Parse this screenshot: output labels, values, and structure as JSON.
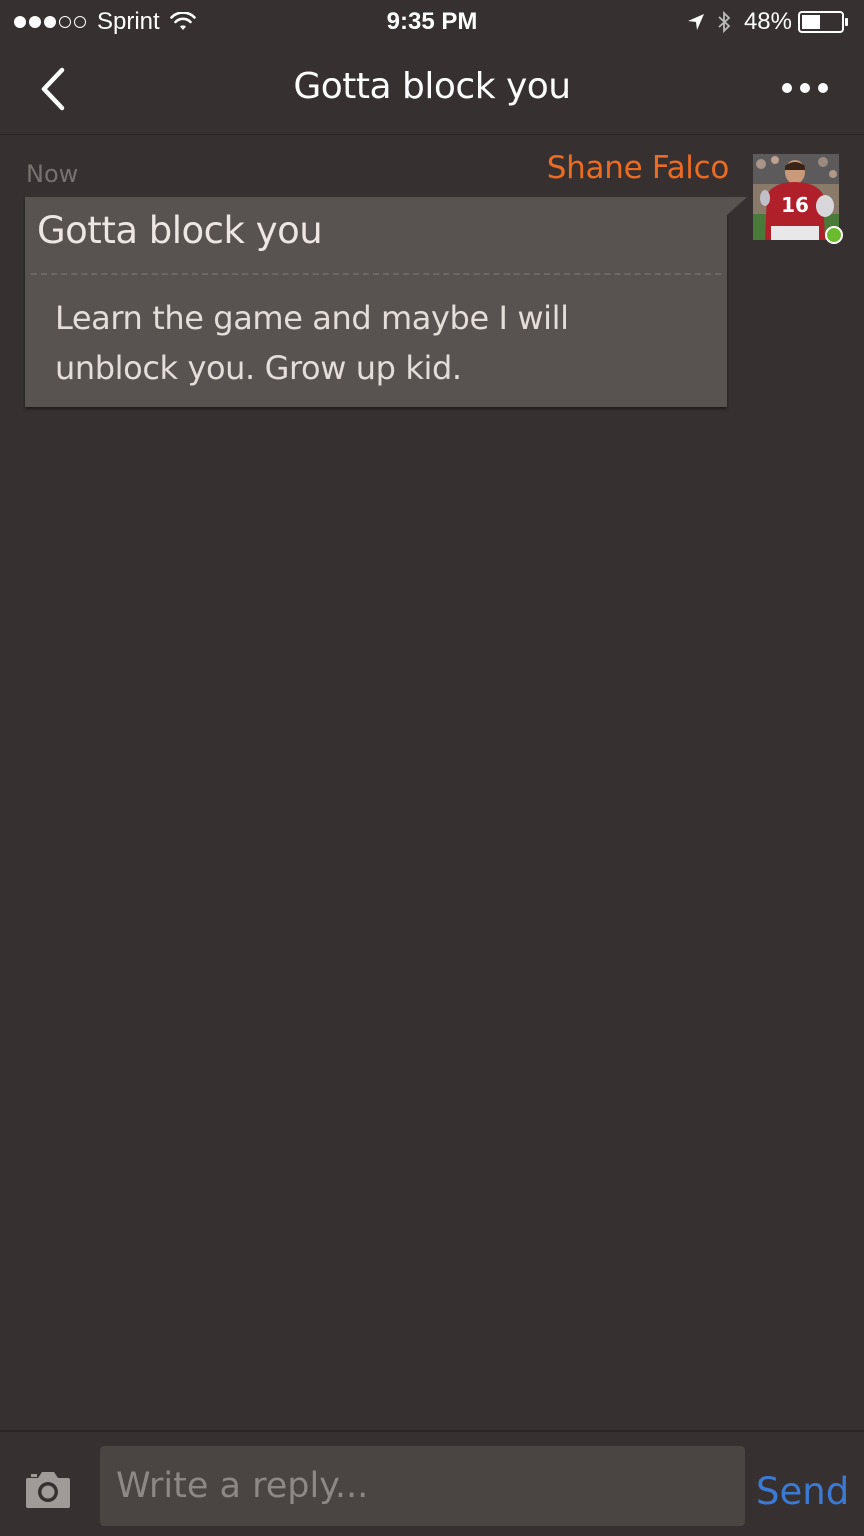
{
  "status_bar": {
    "carrier": "Sprint",
    "signal_strength_bars": 3,
    "signal_total_bars": 5,
    "time": "9:35 PM",
    "battery": "48%",
    "battery_level": 0.48,
    "icons": [
      "wifi-icon",
      "location-arrow-icon",
      "bluetooth-icon",
      "battery-icon"
    ]
  },
  "nav": {
    "title": "Gotta block you",
    "back_icon": "chevron-left-icon",
    "more_icon": "ellipsis-icon"
  },
  "message": {
    "timestamp": "Now",
    "sender": "Shane Falco",
    "subject": "Gotta block you",
    "body": "Learn the game and maybe I will unblock you. Grow up kid.",
    "avatar_icon": "football-player-avatar",
    "online": true
  },
  "reply": {
    "placeholder": "Write a reply...",
    "send_label": "Send",
    "camera_icon": "camera-icon"
  },
  "colors": {
    "background": "#363130",
    "bubble": "#585250",
    "sender_accent": "#ec6b22",
    "send_accent": "#3b7ad4",
    "online": "#6bbb2e"
  }
}
